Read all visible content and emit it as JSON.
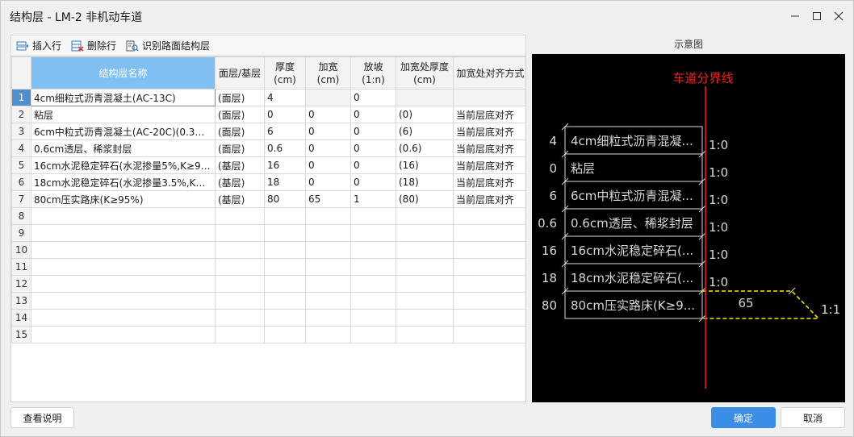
{
  "window": {
    "title": "结构层 - LM-2 非机动车道",
    "minimize_icon": "minimize-icon",
    "maximize_icon": "maximize-icon",
    "close_icon": "close-icon"
  },
  "toolbar": {
    "insert_label": "插入行",
    "delete_label": "删除行",
    "recognize_label": "识别路面结构层"
  },
  "table": {
    "headers": [
      "",
      "结构层名称",
      "面层/基层",
      "厚度\n(cm)",
      "加宽\n(cm)",
      "放坡\n(1:n)",
      "加宽处厚度\n(cm)",
      "加宽处对齐方式"
    ],
    "rows": [
      {
        "n": "1",
        "name": "4cm细粒式沥青混凝土(AC-13C)",
        "type": "(面层)",
        "thick": "4",
        "widen": "",
        "slope": "0",
        "wthick": "",
        "align": ""
      },
      {
        "n": "2",
        "name": "粘层",
        "type": "(面层)",
        "thick": "0",
        "widen": "0",
        "slope": "0",
        "wthick": "(0)",
        "align": "当前层底对齐"
      },
      {
        "n": "3",
        "name": "6cm中粒式沥青混凝土(AC-20C)(0.3%...",
        "type": "(面层)",
        "thick": "6",
        "widen": "0",
        "slope": "0",
        "wthick": "(6)",
        "align": "当前层底对齐"
      },
      {
        "n": "4",
        "name": "0.6cm透层、稀浆封层",
        "type": "(面层)",
        "thick": "0.6",
        "widen": "0",
        "slope": "0",
        "wthick": "(0.6)",
        "align": "当前层底对齐"
      },
      {
        "n": "5",
        "name": "16cm水泥稳定碎石(水泥掺量5%,K≥98...",
        "type": "(基层)",
        "thick": "16",
        "widen": "0",
        "slope": "0",
        "wthick": "(16)",
        "align": "当前层底对齐"
      },
      {
        "n": "6",
        "name": "18cm水泥稳定碎石(水泥掺量3.5%,K≥9...",
        "type": "(基层)",
        "thick": "18",
        "widen": "0",
        "slope": "0",
        "wthick": "(18)",
        "align": "当前层底对齐"
      },
      {
        "n": "7",
        "name": "80cm压实路床(K≥95%)",
        "type": "(基层)",
        "thick": "80",
        "widen": "65",
        "slope": "1",
        "wthick": "(80)",
        "align": "当前层底对齐"
      },
      {
        "n": "8",
        "name": "",
        "type": "",
        "thick": "",
        "widen": "",
        "slope": "",
        "wthick": "",
        "align": ""
      },
      {
        "n": "9",
        "name": "",
        "type": "",
        "thick": "",
        "widen": "",
        "slope": "",
        "wthick": "",
        "align": ""
      },
      {
        "n": "10",
        "name": "",
        "type": "",
        "thick": "",
        "widen": "",
        "slope": "",
        "wthick": "",
        "align": ""
      },
      {
        "n": "11",
        "name": "",
        "type": "",
        "thick": "",
        "widen": "",
        "slope": "",
        "wthick": "",
        "align": ""
      },
      {
        "n": "12",
        "name": "",
        "type": "",
        "thick": "",
        "widen": "",
        "slope": "",
        "wthick": "",
        "align": ""
      },
      {
        "n": "13",
        "name": "",
        "type": "",
        "thick": "",
        "widen": "",
        "slope": "",
        "wthick": "",
        "align": ""
      },
      {
        "n": "14",
        "name": "",
        "type": "",
        "thick": "",
        "widen": "",
        "slope": "",
        "wthick": "",
        "align": ""
      },
      {
        "n": "15",
        "name": "",
        "type": "",
        "thick": "",
        "widen": "",
        "slope": "",
        "wthick": "",
        "align": ""
      }
    ]
  },
  "preview": {
    "label": "示意图",
    "divider_label": "车道分界线",
    "layers": [
      {
        "thick": "4",
        "name": "4cm细粒式沥青混凝...",
        "ratio": "1:0"
      },
      {
        "thick": "0",
        "name": "粘层",
        "ratio": "1:0"
      },
      {
        "thick": "6",
        "name": "6cm中粒式沥青混凝...",
        "ratio": "1:0"
      },
      {
        "thick": "0.6",
        "name": "0.6cm透层、稀浆封层",
        "ratio": "1:0"
      },
      {
        "thick": "16",
        "name": "16cm水泥稳定碎石(...",
        "ratio": "1:0"
      },
      {
        "thick": "18",
        "name": "18cm水泥稳定碎石(...",
        "ratio": "1:0"
      },
      {
        "thick": "80",
        "name": "80cm压实路床(K≥9...",
        "ratio": ""
      }
    ],
    "widen_value": "65",
    "widen_ratio": "1:1",
    "colors": {
      "divider": "#ff1a1a",
      "widen": "#ffe600",
      "line": "#d9d9d9",
      "text": "#d9d9d9"
    }
  },
  "footer": {
    "help_label": "查看说明",
    "ok_label": "确定",
    "cancel_label": "取消"
  }
}
